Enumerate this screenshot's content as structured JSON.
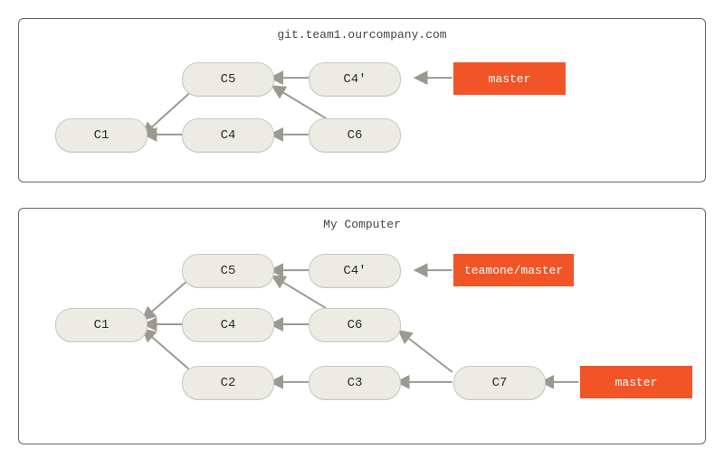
{
  "top": {
    "title": "git.team1.ourcompany.com",
    "nodes": {
      "c1": "C1",
      "c4": "C4",
      "c5": "C5",
      "c6": "C6",
      "c4p": "C4'"
    },
    "refs": {
      "master": "master"
    }
  },
  "bottom": {
    "title": "My Computer",
    "nodes": {
      "c1": "C1",
      "c2": "C2",
      "c3": "C3",
      "c4": "C4",
      "c5": "C5",
      "c6": "C6",
      "c4p": "C4'",
      "c7": "C7"
    },
    "refs": {
      "teamone": "teamone/master",
      "master": "master"
    }
  }
}
